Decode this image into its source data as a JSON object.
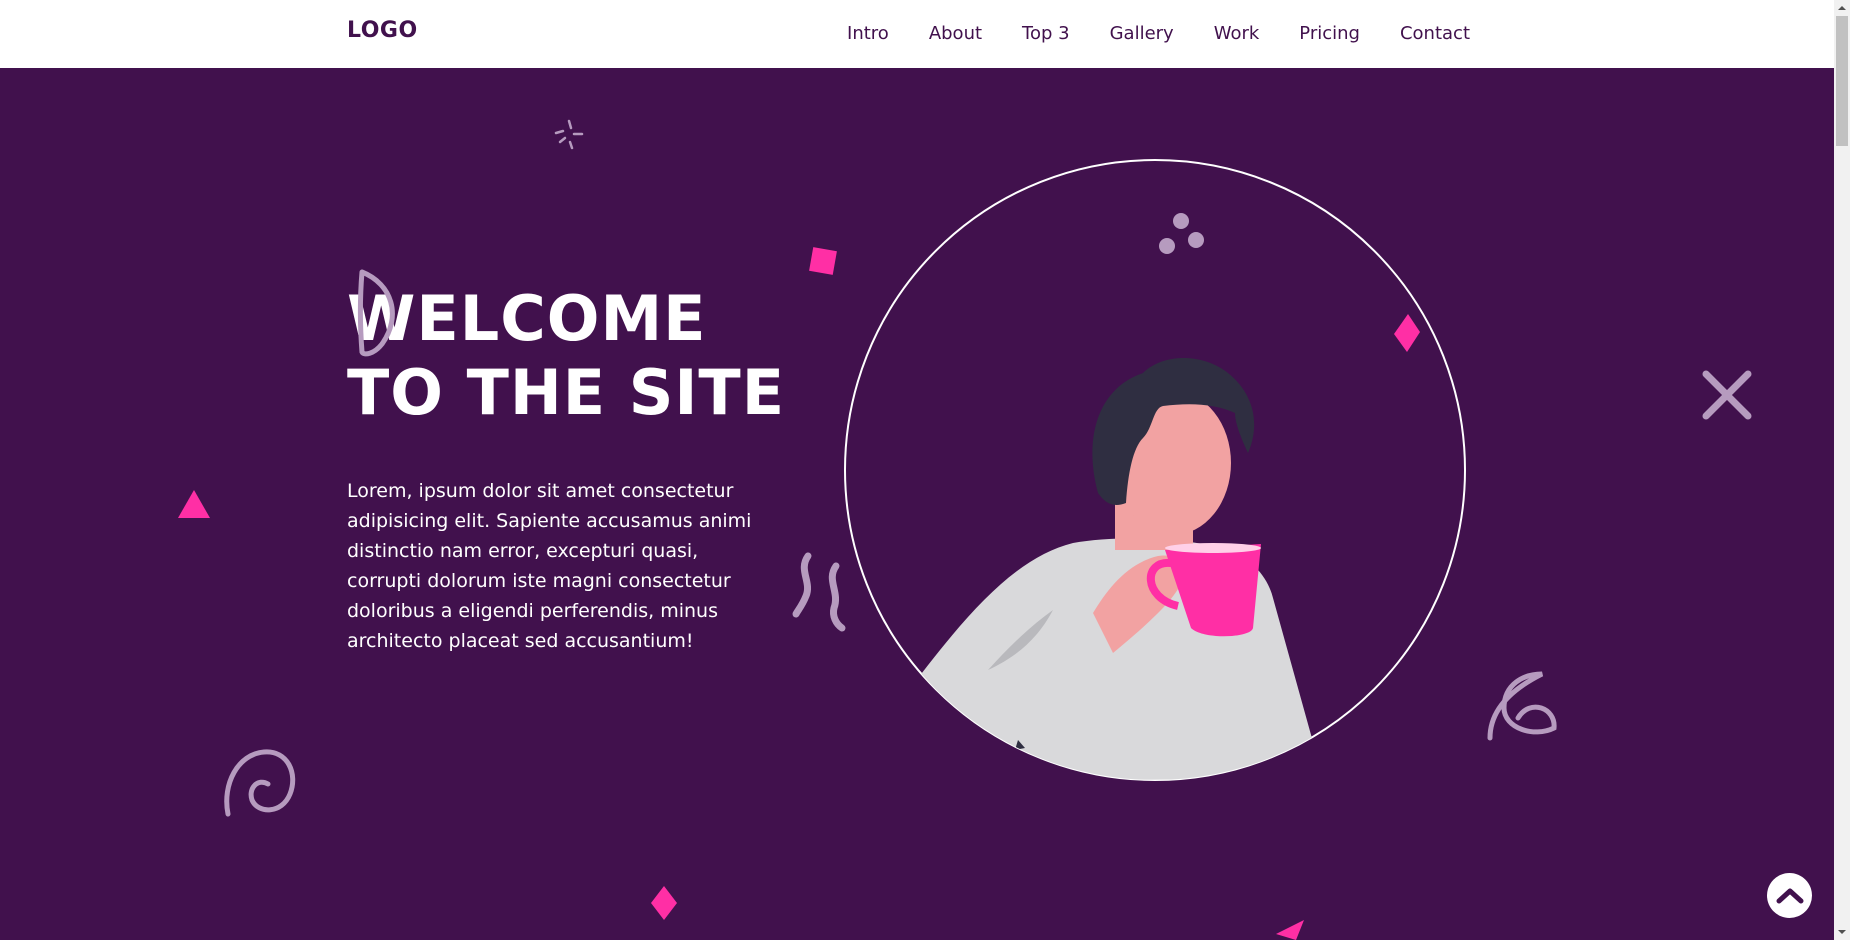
{
  "header": {
    "logo": "LOGO",
    "nav": [
      "Intro",
      "About",
      "Top 3",
      "Gallery",
      "Work",
      "Pricing",
      "Contact"
    ]
  },
  "hero": {
    "title_line1": "WELCOME",
    "title_line2": "TO THE SITE",
    "text": "Lorem, ipsum dolor sit amet consectetur adipisicing elit. Sapiente accusamus animi distinctio nam error, excepturi quasi, corrupti dolorum iste magni consectetur doloribus a eligendi perferendis, minus architecto placeat sed accusantium!"
  },
  "icons": {
    "back_to_top": "chevron-up-icon"
  },
  "colors": {
    "background": "#41114d",
    "accent": "#ff2fa5",
    "header": "#ffffff",
    "decor_muted": "#b69bbf"
  }
}
